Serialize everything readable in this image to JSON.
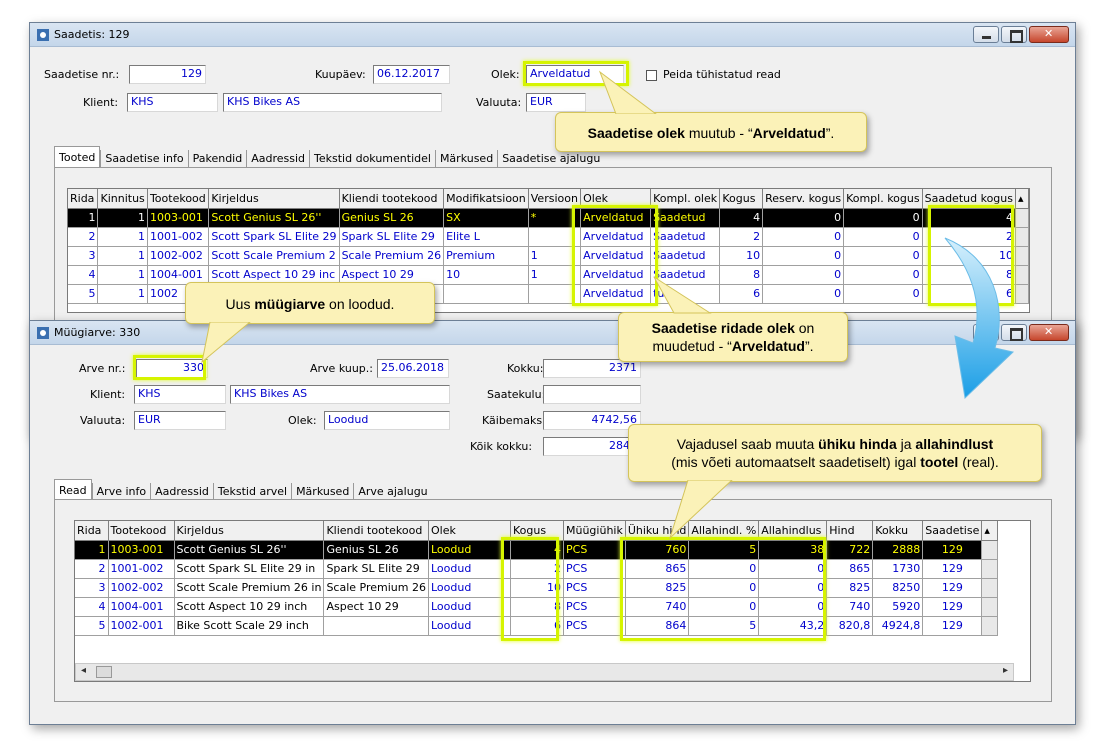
{
  "win1": {
    "title": "Saadetis: 129",
    "saadetise_nr_label": "Saadetise nr.:",
    "saadetise_nr": "129",
    "kuupaev_label": "Kuupäev:",
    "kuupaev": "06.12.2017",
    "olek_label": "Olek:",
    "olek": "Arveldatud",
    "peida_label": "Peida tühistatud read",
    "klient_label": "Klient:",
    "klient_code": "KHS",
    "klient_name": "KHS Bikes AS",
    "valuuta_label": "Valuuta:",
    "valuuta": "EUR",
    "tabs": [
      "Tooted",
      "Saadetise info",
      "Pakendid",
      "Aadressid",
      "Tekstid dokumentidel",
      "Märkused",
      "Saadetise ajalugu"
    ],
    "columns": [
      "Rida",
      "Kinnitus",
      "Tootekood",
      "Kirjeldus",
      "Kliendi tootekood",
      "Modifikatsioon",
      "Versioon",
      "Olek",
      "Kompl. olek",
      "Kogus",
      "Reserv. kogus",
      "Kompl. kogus",
      "Saadetud kogus"
    ],
    "rows": [
      [
        "1",
        "1",
        "1003-001",
        "Scott Genius SL 26''",
        "Genius SL 26",
        "SX",
        "*",
        "Arveldatud",
        "Saadetud",
        "4",
        "0",
        "0",
        "4"
      ],
      [
        "2",
        "1",
        "1001-002",
        "Scott Spark SL Elite 29",
        "Spark SL Elite 29",
        "Elite L",
        "",
        "Arveldatud",
        "Saadetud",
        "2",
        "0",
        "0",
        "2"
      ],
      [
        "3",
        "1",
        "1002-002",
        "Scott Scale Premium 2",
        "Scale Premium 26",
        "Premium",
        "1",
        "Arveldatud",
        "Saadetud",
        "10",
        "0",
        "0",
        "10"
      ],
      [
        "4",
        "1",
        "1004-001",
        "Scott Aspect 10 29 inc",
        "Aspect 10 29",
        "10",
        "1",
        "Arveldatud",
        "Saadetud",
        "8",
        "0",
        "0",
        "8"
      ],
      [
        "5",
        "1",
        "1002",
        "",
        "",
        "",
        "",
        "Arveldatud",
        "tud",
        "6",
        "0",
        "0",
        "6"
      ]
    ]
  },
  "win2": {
    "title": "Müügiarve: 330",
    "arve_nr_label": "Arve nr.:",
    "arve_nr": "330",
    "arve_kuup_label": "Arve kuup.:",
    "arve_kuup": "25.06.2018",
    "kokku_label": "Kokku:",
    "kokku": "2371",
    "klient_label": "Klient:",
    "klient_code": "KHS",
    "klient_name": "KHS Bikes AS",
    "saatekulu_label": "Saatekulu:",
    "saatekulu": "",
    "valuuta_label": "Valuuta:",
    "valuuta": "EUR",
    "olek_label": "Olek:",
    "olek": "Loodud",
    "kaibemaks_label": "Käibemaks:",
    "kaibemaks": "4742,56",
    "koik_kokku_label": "Kõik kokku:",
    "koik_kokku": "2845",
    "tabs": [
      "Read",
      "Arve info",
      "Aadressid",
      "Tekstid arvel",
      "Märkused",
      "Arve ajalugu"
    ],
    "columns": [
      "Rida",
      "Tootekood",
      "Kirjeldus",
      "Kliendi tootekood",
      "Olek",
      "Kogus",
      "Müügiühik",
      "Ühiku hind",
      "Allahindl. %",
      "Allahindlus",
      "Hind",
      "Kokku",
      "Saadetise"
    ],
    "rows": [
      [
        "1",
        "1003-001",
        "Scott Genius SL 26''",
        "Genius SL 26",
        "Loodud",
        "4",
        "PCS",
        "760",
        "5",
        "38",
        "722",
        "2888",
        "129"
      ],
      [
        "2",
        "1001-002",
        "Scott Spark SL Elite 29 in",
        "Spark SL Elite 29",
        "Loodud",
        "2",
        "PCS",
        "865",
        "0",
        "0",
        "865",
        "1730",
        "129"
      ],
      [
        "3",
        "1002-002",
        "Scott Scale Premium 26 in",
        "Scale Premium 26",
        "Loodud",
        "10",
        "PCS",
        "825",
        "0",
        "0",
        "825",
        "8250",
        "129"
      ],
      [
        "4",
        "1004-001",
        "Scott Aspect 10 29 inch",
        "Aspect 10 29",
        "Loodud",
        "8",
        "PCS",
        "740",
        "0",
        "0",
        "740",
        "5920",
        "129"
      ],
      [
        "5",
        "1002-001",
        "Bike Scott Scale 29 inch",
        "",
        "Loodud",
        "6",
        "PCS",
        "864",
        "5",
        "43,2",
        "820,8",
        "4924,8",
        "129"
      ]
    ]
  },
  "callouts": {
    "olek": {
      "pre": "",
      "b1": "Saadetise olek",
      "mid": " muutub - “",
      "b2": "Arveldatud",
      "post": "”."
    },
    "ridade": {
      "b1": "Saadetise ridade olek",
      "mid": " on",
      "line2pre": "muudetud - “",
      "b2": "Arveldatud",
      "post": "”."
    },
    "muugiarve": {
      "pre": "Uus ",
      "b1": "müügiarve",
      "post": " on loodud."
    },
    "hinda": {
      "pre": "Vajadusel saab muuta ",
      "b1": "ühiku hinda",
      "mid": " ja ",
      "b2": "allahindlust",
      "line2pre": "(mis võeti automaatselt saadetiselt) igal ",
      "b3": "tootel",
      "post": " (real)."
    }
  },
  "colors": {
    "highlight": "#d6f400",
    "callout_bg": "#fbf2b8",
    "link_text": "#0000cc",
    "arrow": "#29a8e8"
  }
}
